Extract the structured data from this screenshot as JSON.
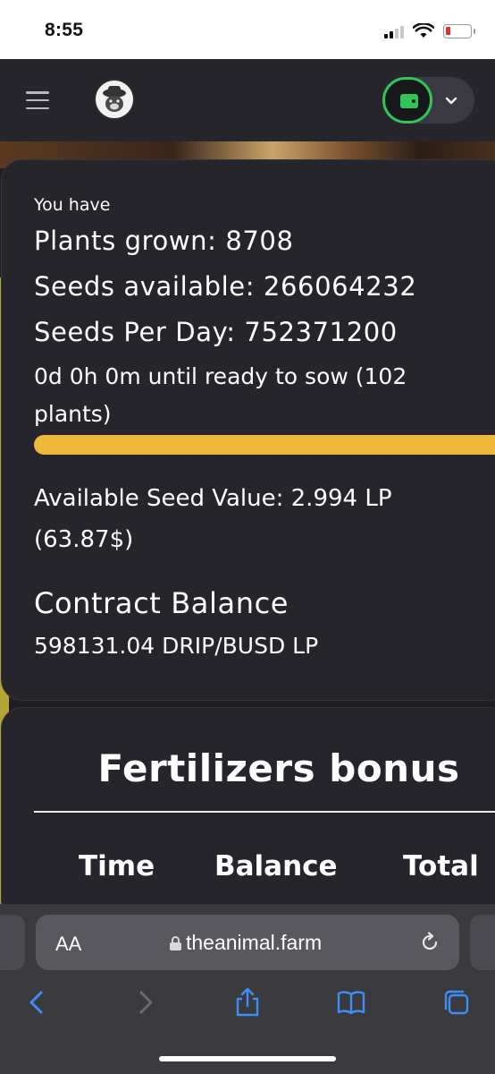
{
  "status_bar": {
    "time": "8:55"
  },
  "header": {
    "menu_icon": "hamburger-icon",
    "logo_icon": "animal-farm-logo",
    "wallet_icon": "wallet-icon",
    "dropdown_icon": "chevron-down-icon",
    "accent": "#33c45a"
  },
  "stats": {
    "intro": "You have",
    "plants_grown": "Plants grown: 8708",
    "seeds_available": "Seeds available: 266064232",
    "seeds_per_day": "Seeds Per Day: 752371200",
    "countdown": "0d 0h 0m until ready to sow (102 plants)",
    "progress": 1.0,
    "progress_color": "#f0b83a",
    "available_value": "Available Seed Value: 2.994 LP (63.87$)"
  },
  "contract": {
    "title": "Contract Balance",
    "value": "598131.04 DRIP/BUSD LP"
  },
  "fertilizers": {
    "title": "Fertilizers bonus",
    "columns": [
      "Time",
      "Balance",
      "Total"
    ]
  },
  "browser": {
    "aa_label": "AA",
    "url": "theanimal.farm",
    "icons": [
      "back-icon",
      "forward-icon",
      "share-icon",
      "bookmarks-icon",
      "tabs-icon"
    ]
  }
}
